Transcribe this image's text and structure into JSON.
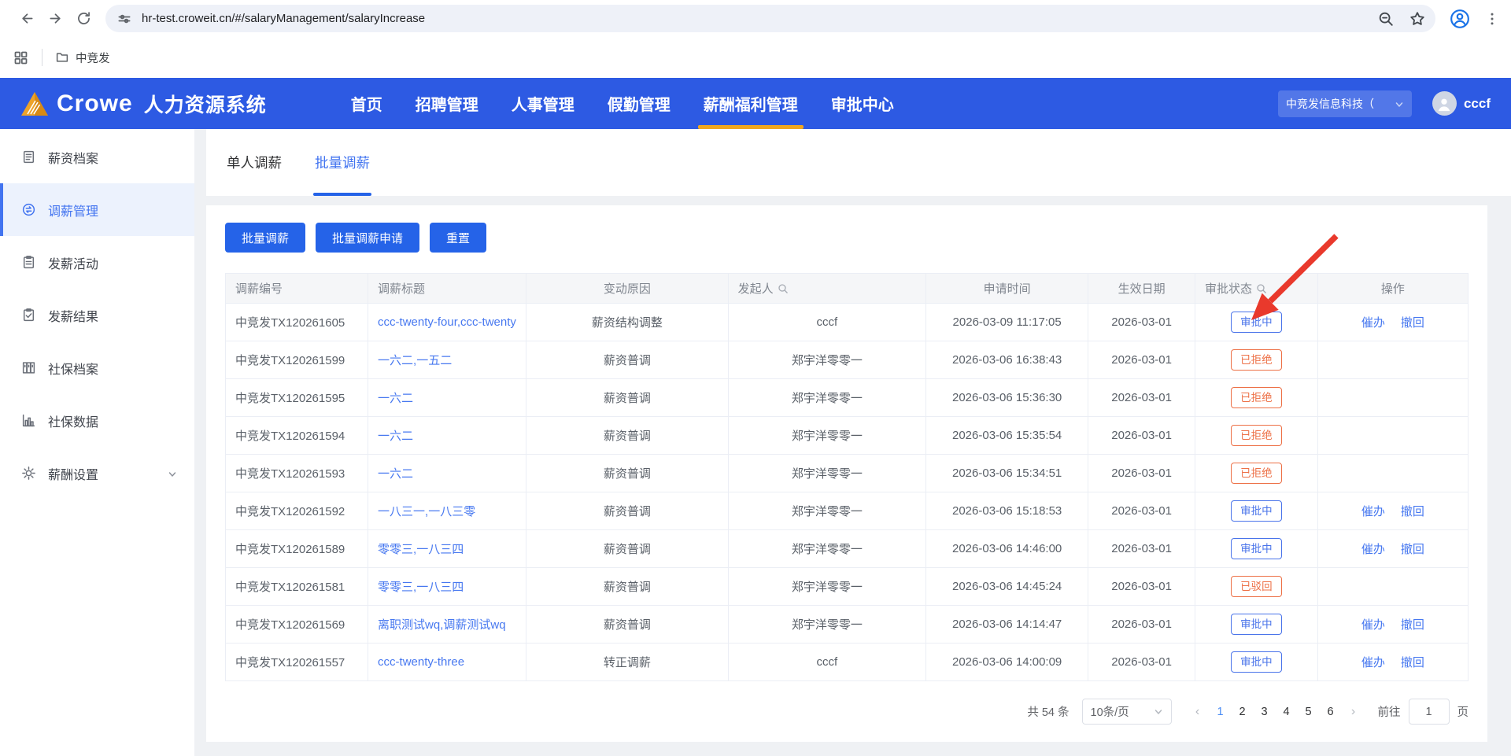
{
  "browser": {
    "url": "hr-test.croweit.cn/#/salaryManagement/salaryIncrease",
    "bookmarks": {
      "folder_label": "中竞发"
    }
  },
  "header": {
    "brand": "Crowe",
    "app_title": "人力资源系统",
    "nav": [
      {
        "label": "首页",
        "active": false
      },
      {
        "label": "招聘管理",
        "active": false
      },
      {
        "label": "人事管理",
        "active": false
      },
      {
        "label": "假勤管理",
        "active": false
      },
      {
        "label": "薪酬福利管理",
        "active": true
      },
      {
        "label": "审批中心",
        "active": false
      }
    ],
    "company_select": "中竞发信息科技（",
    "username": "cccf",
    "active_underline_color": "#f0a71f"
  },
  "sidebar": {
    "items": [
      {
        "label": "薪资档案",
        "icon": "doc",
        "active": false
      },
      {
        "label": "调薪管理",
        "icon": "exchange",
        "active": true
      },
      {
        "label": "发薪活动",
        "icon": "clipboard",
        "active": false
      },
      {
        "label": "发薪结果",
        "icon": "clipcheck",
        "active": false
      },
      {
        "label": "社保档案",
        "icon": "cabinet",
        "active": false
      },
      {
        "label": "社保数据",
        "icon": "chart",
        "active": false
      },
      {
        "label": "薪酬设置",
        "icon": "gear",
        "active": false,
        "expandable": true
      }
    ]
  },
  "tabs": [
    {
      "label": "单人调薪",
      "active": false
    },
    {
      "label": "批量调薪",
      "active": true
    }
  ],
  "toolbar": {
    "buttons": [
      "批量调薪",
      "批量调薪申请",
      "重置"
    ]
  },
  "table": {
    "columns": [
      {
        "key": "id",
        "label": "调薪编号",
        "searchable": false
      },
      {
        "key": "title",
        "label": "调薪标题",
        "searchable": false
      },
      {
        "key": "reason",
        "label": "变动原因",
        "searchable": false
      },
      {
        "key": "initiator",
        "label": "发起人",
        "searchable": true
      },
      {
        "key": "apply_time",
        "label": "申请时间",
        "searchable": false
      },
      {
        "key": "effective_date",
        "label": "生效日期",
        "searchable": false
      },
      {
        "key": "status",
        "label": "审批状态",
        "searchable": true
      },
      {
        "key": "actions",
        "label": "操作",
        "searchable": false
      }
    ],
    "rows": [
      {
        "id": "中竞发TX120261605",
        "title": "ccc-twenty-four,ccc-twenty",
        "reason": "薪资结构调整",
        "initiator": "cccf",
        "apply_time": "2026-03-09 11:17:05",
        "effective_date": "2026-03-01",
        "status": "审批中",
        "status_type": "processing",
        "actions": [
          "催办",
          "撤回"
        ]
      },
      {
        "id": "中竞发TX120261599",
        "title": "一六二,一五二",
        "reason": "薪资普调",
        "initiator": "郑宇洋零零一",
        "apply_time": "2026-03-06 16:38:43",
        "effective_date": "2026-03-01",
        "status": "已拒绝",
        "status_type": "warning",
        "actions": []
      },
      {
        "id": "中竞发TX120261595",
        "title": "一六二",
        "reason": "薪资普调",
        "initiator": "郑宇洋零零一",
        "apply_time": "2026-03-06 15:36:30",
        "effective_date": "2026-03-01",
        "status": "已拒绝",
        "status_type": "warning",
        "actions": []
      },
      {
        "id": "中竞发TX120261594",
        "title": "一六二",
        "reason": "薪资普调",
        "initiator": "郑宇洋零零一",
        "apply_time": "2026-03-06 15:35:54",
        "effective_date": "2026-03-01",
        "status": "已拒绝",
        "status_type": "warning",
        "actions": []
      },
      {
        "id": "中竞发TX120261593",
        "title": "一六二",
        "reason": "薪资普调",
        "initiator": "郑宇洋零零一",
        "apply_time": "2026-03-06 15:34:51",
        "effective_date": "2026-03-01",
        "status": "已拒绝",
        "status_type": "warning",
        "actions": []
      },
      {
        "id": "中竞发TX120261592",
        "title": "一八三一,一八三零",
        "reason": "薪资普调",
        "initiator": "郑宇洋零零一",
        "apply_time": "2026-03-06 15:18:53",
        "effective_date": "2026-03-01",
        "status": "审批中",
        "status_type": "processing",
        "actions": [
          "催办",
          "撤回"
        ]
      },
      {
        "id": "中竞发TX120261589",
        "title": "零零三,一八三四",
        "reason": "薪资普调",
        "initiator": "郑宇洋零零一",
        "apply_time": "2026-03-06 14:46:00",
        "effective_date": "2026-03-01",
        "status": "审批中",
        "status_type": "processing",
        "actions": [
          "催办",
          "撤回"
        ]
      },
      {
        "id": "中竞发TX120261581",
        "title": "零零三,一八三四",
        "reason": "薪资普调",
        "initiator": "郑宇洋零零一",
        "apply_time": "2026-03-06 14:45:24",
        "effective_date": "2026-03-01",
        "status": "已驳回",
        "status_type": "warning",
        "actions": []
      },
      {
        "id": "中竞发TX120261569",
        "title": "离职测试wq,调薪测试wq",
        "reason": "薪资普调",
        "initiator": "郑宇洋零零一",
        "apply_time": "2026-03-06 14:14:47",
        "effective_date": "2026-03-01",
        "status": "审批中",
        "status_type": "processing",
        "actions": [
          "催办",
          "撤回"
        ]
      },
      {
        "id": "中竞发TX120261557",
        "title": "ccc-twenty-three",
        "reason": "转正调薪",
        "initiator": "cccf",
        "apply_time": "2026-03-06 14:00:09",
        "effective_date": "2026-03-01",
        "status": "审批中",
        "status_type": "processing",
        "actions": [
          "催办",
          "撤回"
        ]
      }
    ]
  },
  "status_colors": {
    "processing": "#4a74ea",
    "warning": "#ed7046"
  },
  "pagination": {
    "total_label": "共 54 条",
    "page_size_label": "10条/页",
    "pages": [
      "1",
      "2",
      "3",
      "4",
      "5",
      "6"
    ],
    "current_page": "1",
    "goto_label": "前往",
    "goto_value": "1",
    "goto_suffix": "页"
  },
  "annotation": {
    "type": "arrow",
    "color": "#e9392c",
    "points_at": "第一行 审批中 状态"
  }
}
